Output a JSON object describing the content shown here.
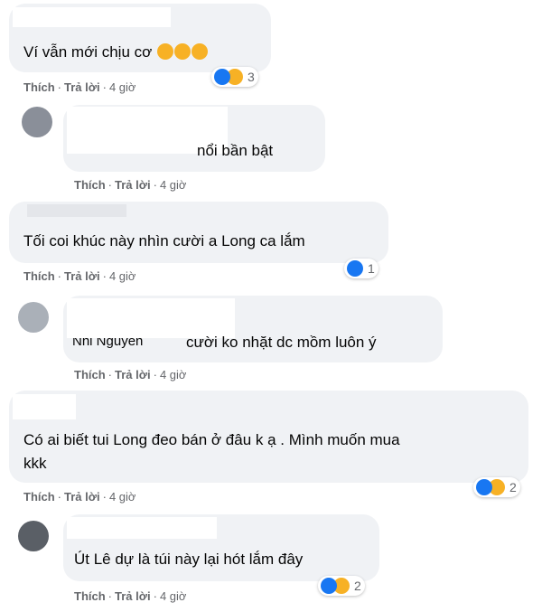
{
  "comments": [
    {
      "text": "Ví vẫn mới chịu cơ",
      "emoji": [
        "rolling-laughing",
        "rolling-laughing",
        "rolling-laughing"
      ],
      "reaction_count": "3",
      "reactions": [
        "like",
        "haha"
      ],
      "like": "Thích",
      "reply": "Trả lời",
      "time": "4 giờ"
    },
    {
      "text": "nổi bần bật",
      "like": "Thích",
      "reply": "Trả lời",
      "time": "4 giờ"
    },
    {
      "text": "Tối coi khúc này nhìn cười a Long ca lắm",
      "reaction_count": "1",
      "reactions": [
        "like"
      ],
      "like": "Thích",
      "reply": "Trả lời",
      "time": "4 giờ"
    },
    {
      "partial_name": "Nhi Nguyễn",
      "text": "cười ko nhặt dc mồm luôn ý",
      "like": "Thích",
      "reply": "Trả lời",
      "time": "4 giờ"
    },
    {
      "text_line1": "Có ai biết tui Long đeo bán ở đâu k ạ . Mình muốn mua",
      "text_line2": "kkk",
      "reaction_count": "2",
      "reactions": [
        "like",
        "haha"
      ],
      "like": "Thích",
      "reply": "Trả lời",
      "time": "4 giờ"
    },
    {
      "text": "Út Lê dự là túi này lại hót lắm đây",
      "reaction_count": "2",
      "reactions": [
        "like",
        "haha"
      ],
      "like": "Thích",
      "reply": "Trả lời",
      "time": "4 giờ"
    }
  ],
  "colors": {
    "like": "#1877f2",
    "haha": "#f7b125",
    "bubble": "#f0f2f5",
    "meta": "#65676b"
  }
}
